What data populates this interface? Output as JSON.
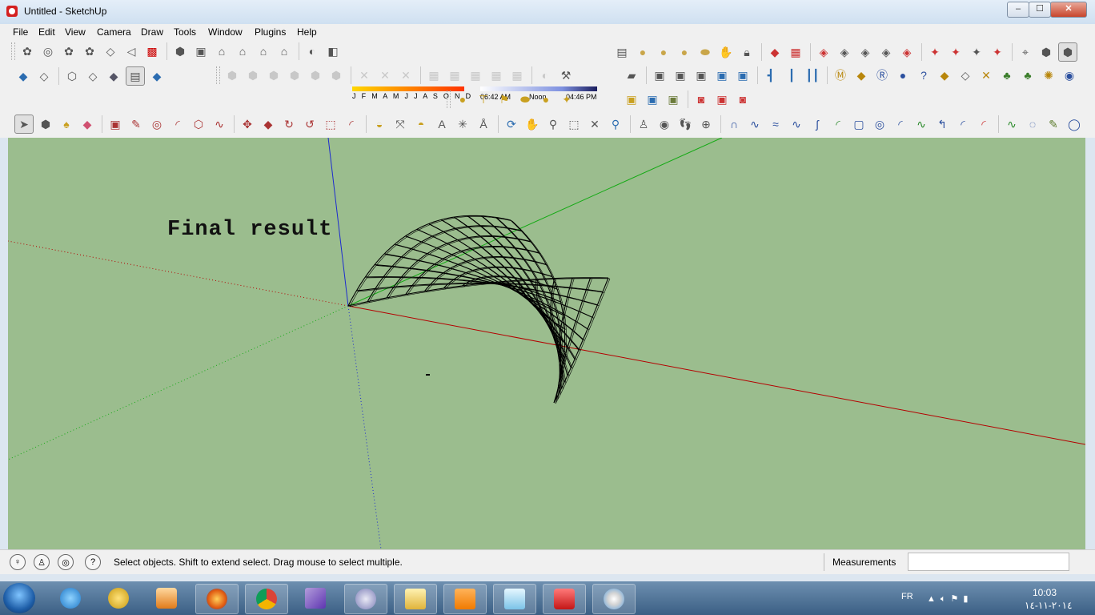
{
  "window": {
    "title": "Untitled - SketchUp",
    "minimize": "–",
    "maximize": "☐",
    "close": "✕"
  },
  "menu": [
    "File",
    "Edit",
    "View",
    "Camera",
    "Draw",
    "Tools",
    "Window",
    "Plugins",
    "Help"
  ],
  "shadow_settings": {
    "months": "J F M A M J J A S O N D",
    "time_start": "06:42 AM",
    "time_noon": "Noon",
    "time_end": "04:46 PM"
  },
  "viewport": {
    "annotation": "Final result",
    "background_color": "#9bbd8e",
    "model": "wireframe-saddle-surface",
    "axis_colors": {
      "red": "#b40000",
      "green": "#14aa14",
      "blue": "#1c2ad0"
    }
  },
  "status": {
    "hint": "Select objects. Shift to extend select. Drag mouse to select multiple.",
    "measurements_label": "Measurements",
    "measurements_value": ""
  },
  "taskbar": {
    "apps": [
      "internet-explorer",
      "gamepad",
      "media-player",
      "firefox",
      "chrome",
      "visual-studio",
      "broadcast",
      "file-explorer",
      "vlc",
      "notepad",
      "sketchup",
      "paint"
    ],
    "language": "FR",
    "time": "10:03",
    "date": "٢٠١٤-١١-١٤"
  }
}
